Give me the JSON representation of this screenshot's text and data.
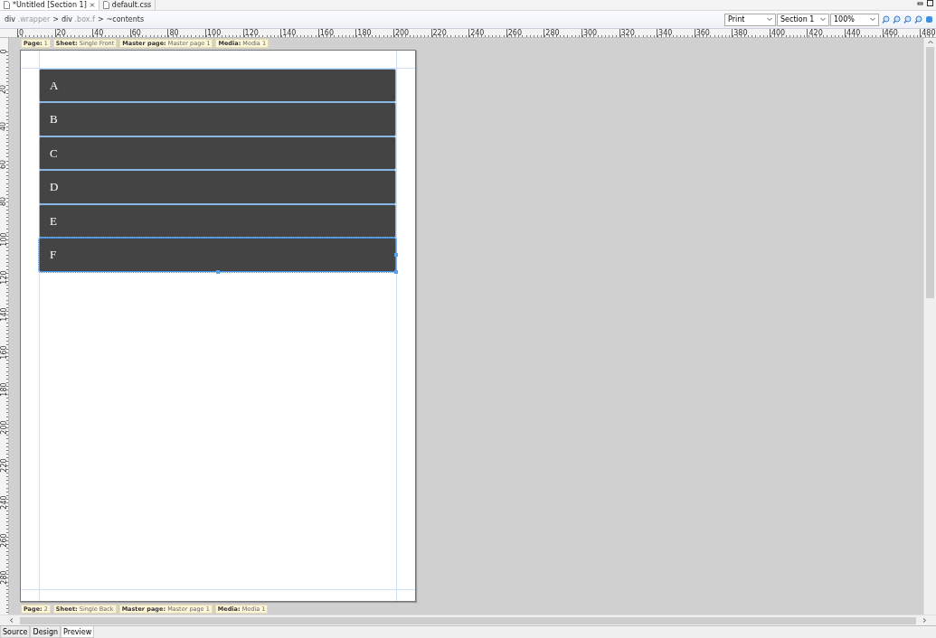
{
  "editor_tabs": [
    {
      "label": "*Untitled [Section 1]",
      "selected": true,
      "closable": true
    },
    {
      "label": "default.css",
      "selected": false,
      "closable": false
    }
  ],
  "breadcrumb": [
    {
      "kind": "node",
      "tag": "div",
      "cls": ".wrapper"
    },
    {
      "kind": "sep",
      "tag": ">"
    },
    {
      "kind": "node",
      "tag": "div",
      "cls": ".box.f"
    },
    {
      "kind": "sep",
      "tag": ">"
    },
    {
      "kind": "node",
      "tag": "~contents"
    }
  ],
  "toolbar": {
    "media": "Print",
    "section": "Section 1",
    "zoom": "100%"
  },
  "ruler": {
    "h_labels": [
      "0",
      "20",
      "40",
      "60",
      "80",
      "100",
      "120",
      "140",
      "160",
      "180",
      "200",
      "220",
      "240",
      "260",
      "280",
      "300",
      "320",
      "340",
      "360",
      "380",
      "400",
      "420",
      "440",
      "460",
      "480"
    ],
    "v_labels": [
      "0",
      "20",
      "40",
      "60",
      "80",
      "100",
      "120",
      "140",
      "160",
      "180",
      "200",
      "220",
      "240",
      "260",
      "280"
    ]
  },
  "page_info": [
    {
      "key": "Page:",
      "value": "1"
    },
    {
      "key": "Sheet:",
      "value": "Single Front"
    },
    {
      "key": "Master page:",
      "value": "Master page 1"
    },
    {
      "key": "Media:",
      "value": "Media 1"
    }
  ],
  "boxes": [
    {
      "label": "A",
      "selected": false
    },
    {
      "label": "B",
      "selected": false
    },
    {
      "label": "C",
      "selected": false
    },
    {
      "label": "D",
      "selected": false
    },
    {
      "label": "E",
      "selected": false
    },
    {
      "label": "F",
      "selected": true
    }
  ],
  "page2_info": [
    {
      "key": "Page:",
      "value": "2"
    },
    {
      "key": "Sheet:",
      "value": "Single Back"
    },
    {
      "key": "Master page:",
      "value": "Master page 1"
    },
    {
      "key": "Media:",
      "value": "Media 1"
    }
  ],
  "view_tabs": [
    {
      "label": "Source",
      "selected": false
    },
    {
      "label": "Design",
      "selected": false
    },
    {
      "label": "Preview",
      "selected": true
    }
  ]
}
